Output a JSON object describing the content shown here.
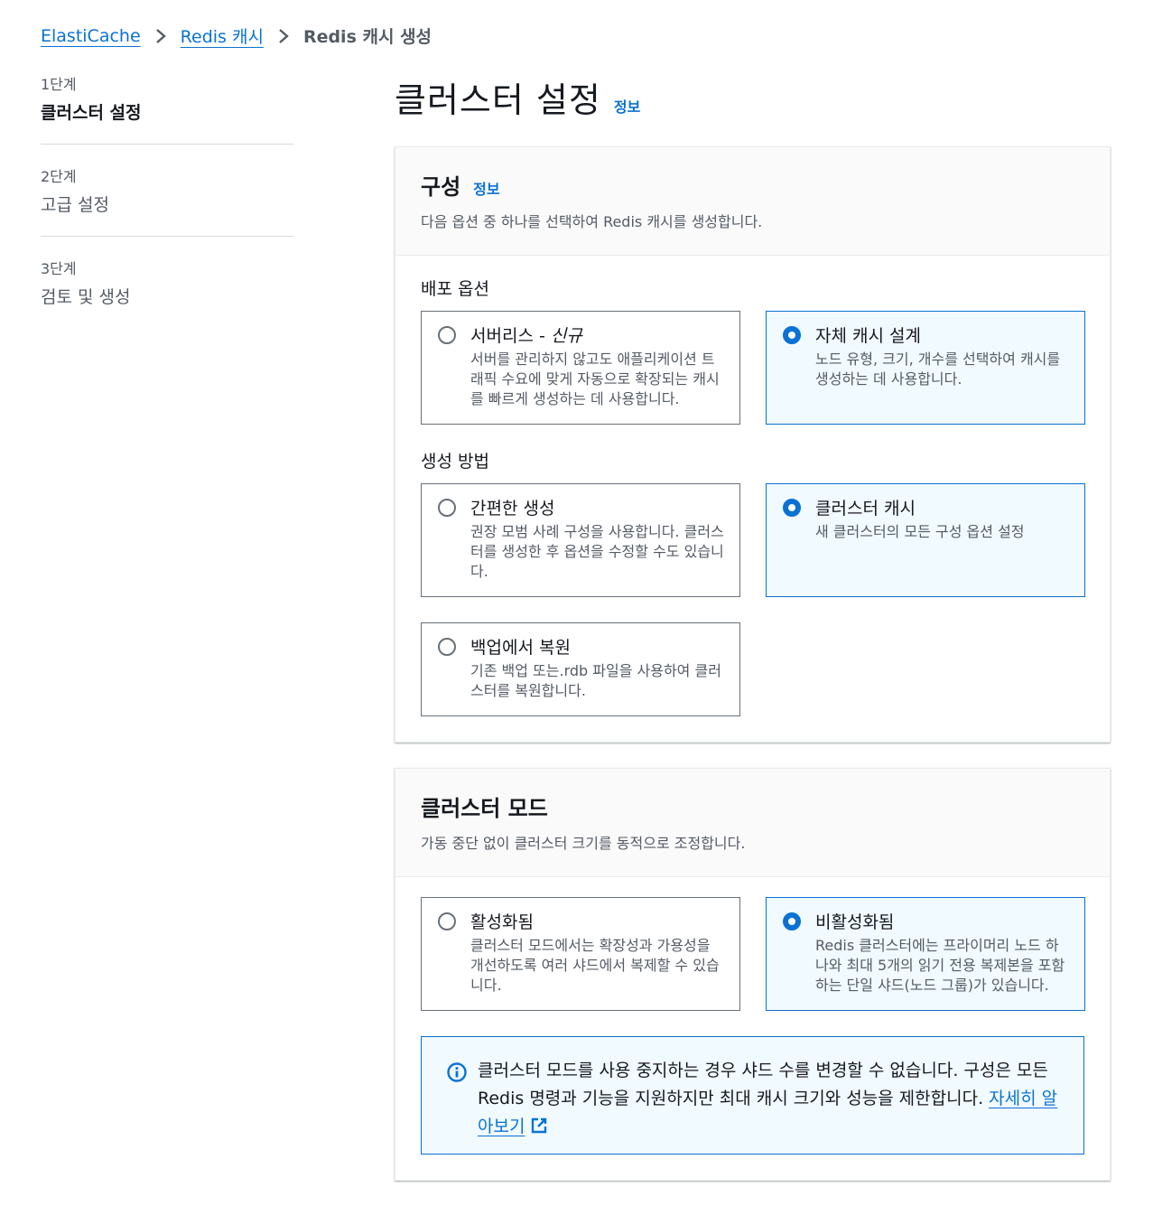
{
  "breadcrumb": {
    "items": [
      "ElastiCache",
      "Redis 캐시"
    ],
    "current": "Redis 캐시 생성"
  },
  "steps": [
    {
      "number": "1단계",
      "title": "클러스터 설정"
    },
    {
      "number": "2단계",
      "title": "고급 설정"
    },
    {
      "number": "3단계",
      "title": "검토 및 생성"
    }
  ],
  "page": {
    "title": "클러스터 설정",
    "info": "정보"
  },
  "config": {
    "title": "구성",
    "info": "정보",
    "description": "다음 옵션 중 하나를 선택하여 Redis 캐시를 생성합니다.",
    "deploy_label": "배포 옵션",
    "serverless": {
      "title": "서버리스 - ",
      "tag": "신규",
      "desc": "서버를 관리하지 않고도 애플리케이션 트래픽 수요에 맞게 자동으로 확장되는 캐시를 빠르게 생성하는 데 사용합니다."
    },
    "design_own": {
      "title": "자체 캐시 설계",
      "desc": "노드 유형, 크기, 개수를 선택하여 캐시를 생성하는 데 사용합니다."
    },
    "method_label": "생성 방법",
    "easy_create": {
      "title": "간편한 생성",
      "desc": "권장 모범 사례 구성을 사용합니다. 클러스터를 생성한 후 옵션을 수정할 수도 있습니다."
    },
    "cluster_cache": {
      "title": "클러스터 캐시",
      "desc": "새 클러스터의 모든 구성 옵션 설정"
    },
    "restore_backup": {
      "title": "백업에서 복원",
      "desc": "기존 백업 또는.rdb 파일을 사용하여 클러스터를 복원합니다."
    }
  },
  "cluster_mode": {
    "title": "클러스터 모드",
    "description": "가동 중단 없이 클러스터 크기를 동적으로 조정합니다.",
    "enabled": {
      "title": "활성화됨",
      "desc": "클러스터 모드에서는 확장성과 가용성을 개선하도록 여러 샤드에서 복제할 수 있습니다."
    },
    "disabled": {
      "title": "비활성화됨",
      "desc": "Redis 클러스터에는 프라이머리 노드 하나와 최대 5개의 읽기 전용 복제본을 포함하는 단일 샤드(노드 그룹)가 있습니다."
    },
    "alert_text": "클러스터 모드를 사용 중지하는 경우 샤드 수를 변경할 수 없습니다. 구성은 모든 Redis 명령과 기능을 지원하지만 최대 캐시 크기와 성능을 제한합니다.",
    "alert_link": "자세히 알아보기"
  },
  "colors": {
    "link": "#0972d3",
    "selected_bg": "#f1faff",
    "text_secondary": "#545b64"
  }
}
